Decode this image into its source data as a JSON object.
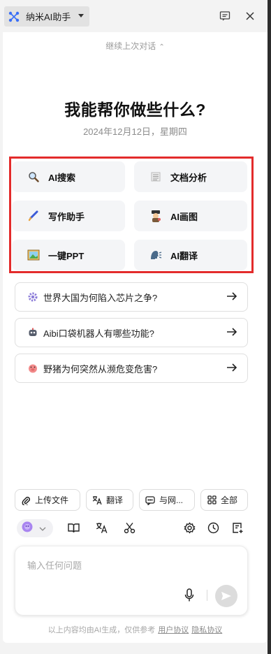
{
  "app": {
    "title": "纳米AI助手",
    "icons": [
      "app-logo-icon",
      "chevron-down-icon",
      "chat-window-icon",
      "close-icon"
    ]
  },
  "conversation": {
    "continue_label": "继续上次对话",
    "continue_icon": "chevron-double-up-icon"
  },
  "hero": {
    "title": "我能帮你做些什么?",
    "date": "2024年12月12日，星期四"
  },
  "features": [
    {
      "label": "AI搜索",
      "icon": "magnifier-icon"
    },
    {
      "label": "文档分析",
      "icon": "document-icon"
    },
    {
      "label": "写作助手",
      "icon": "pen-icon"
    },
    {
      "label": "AI画图",
      "icon": "painter-icon"
    },
    {
      "label": "一键PPT",
      "icon": "picture-icon"
    },
    {
      "label": "AI翻译",
      "icon": "speaking-head-icon"
    }
  ],
  "suggestions": [
    {
      "label": "世界大国为何陷入芯片之争?",
      "icon": "gear-icon"
    },
    {
      "label": "Aibi口袋机器人有哪些功能?",
      "icon": "robot-icon"
    },
    {
      "label": "野猪为何突然从濒危变危害?",
      "icon": "pig-icon"
    }
  ],
  "actions": [
    {
      "label": "上传文件",
      "icon": "paperclip-icon"
    },
    {
      "label": "翻译",
      "icon": "translate-icon"
    },
    {
      "label": "与网...",
      "icon": "chat-bubble-icon"
    },
    {
      "label": "全部",
      "icon": "grid-icon"
    }
  ],
  "toolbar": {
    "icons": [
      "model-avatar-icon",
      "chevron-down-icon",
      "book-icon",
      "translate-icon",
      "scissors-icon",
      "settings-icon",
      "history-icon",
      "new-chat-icon"
    ]
  },
  "input": {
    "placeholder": "输入任何问题"
  },
  "footer": {
    "disclaimer": "以上内容均由AI生成，仅供参考",
    "user_agreement": "用户协议",
    "privacy": "隐私协议"
  },
  "colors": {
    "highlight": "#e32b2b",
    "feature_bg": "#f4f5f7",
    "send_button": "#dcdcdc"
  }
}
